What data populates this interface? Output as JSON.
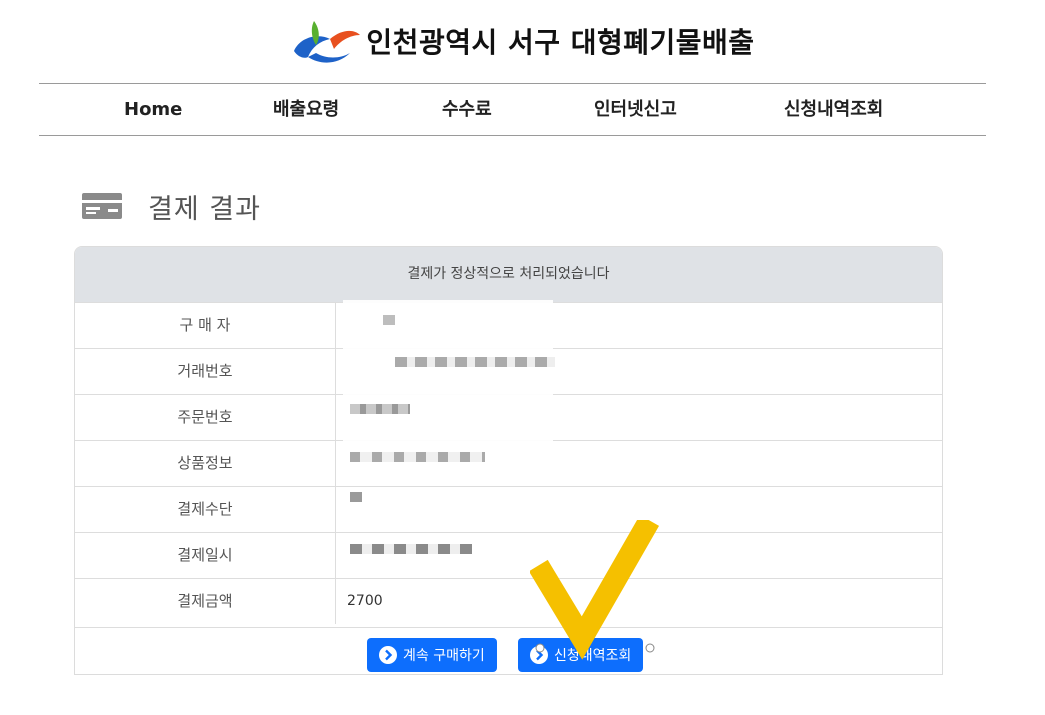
{
  "header": {
    "site_title": "인천광역시 서구 대형폐기물배출",
    "logo_icon": "incheon-seogu-logo-icon"
  },
  "nav": {
    "items": [
      {
        "label": "Home"
      },
      {
        "label": "배출요령"
      },
      {
        "label": "수수료"
      },
      {
        "label": "인터넷신고"
      },
      {
        "label": "신청내역조회"
      }
    ]
  },
  "page": {
    "title": "결제 결과",
    "icon": "credit-card-icon"
  },
  "panel": {
    "message": "결제가 정상적으로 처리되었습니다",
    "rows": [
      {
        "label": "구 매 자",
        "value": ""
      },
      {
        "label": "거래번호",
        "value": ""
      },
      {
        "label": "주문번호",
        "value": ""
      },
      {
        "label": "상품정보",
        "value": ""
      },
      {
        "label": "결제수단",
        "value": ""
      },
      {
        "label": "결제일시",
        "value": ""
      },
      {
        "label": "결제금액",
        "value": "2700"
      }
    ]
  },
  "buttons": {
    "continue_label": "계속 구매하기",
    "history_label": "신청내역조회"
  },
  "colors": {
    "primary": "#0d6efd",
    "panel_header_bg": "#dfe2e6",
    "checkmark": "#f5c000"
  }
}
